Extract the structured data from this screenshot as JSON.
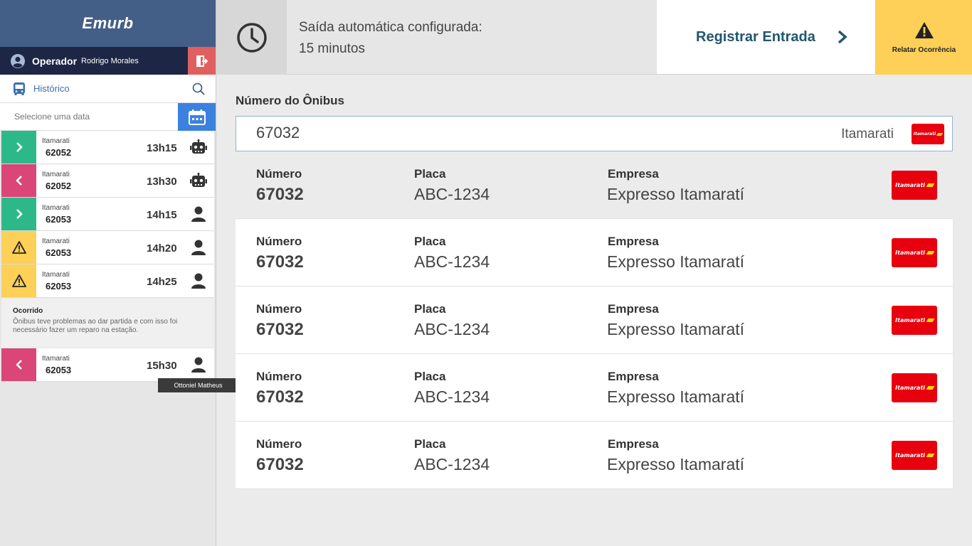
{
  "brand": "Emurb",
  "operator": {
    "label": "Operador",
    "name": "Rodrigo Morales"
  },
  "history": {
    "label": "Histórico",
    "date_placeholder": "Selecione uma data",
    "items": [
      {
        "direction": "in",
        "color": "#2db88a",
        "company": "Itamarati",
        "bus": "62052",
        "time": "13h15",
        "type": "robot-icon"
      },
      {
        "direction": "out",
        "color": "#d94677",
        "company": "Itamarati",
        "bus": "62052",
        "time": "13h30",
        "type": "robot-icon"
      },
      {
        "direction": "in",
        "color": "#2db88a",
        "company": "Itamarati",
        "bus": "62053",
        "time": "14h15",
        "type": "person-icon"
      },
      {
        "direction": "warning",
        "color": "#ffd057",
        "company": "Itamarati",
        "bus": "62053",
        "time": "14h20",
        "type": "person-icon"
      },
      {
        "direction": "warning",
        "color": "#ffd057",
        "company": "Itamarati",
        "bus": "62053",
        "time": "14h25",
        "type": "person-icon"
      },
      {
        "direction": "out",
        "color": "#d94677",
        "company": "Itamarati",
        "bus": "62053",
        "time": "15h30",
        "type": "person-icon"
      }
    ],
    "occurrence": {
      "title": "Ocorrido",
      "text": "Ônibus teve problemas ao dar partida e com isso foi necessário fazer um reparo na estação."
    },
    "tooltip": "Ottoniel Matheus"
  },
  "topbar": {
    "auto_exit_line1": "Saída automática configurada:",
    "auto_exit_line2": "15 minutos",
    "register_label": "Registrar Entrada",
    "report_label": "Relatar Ocorrência"
  },
  "main": {
    "title": "Número do Ônibus",
    "search_value": "67032",
    "search_company": "Itamarati",
    "logo_text": "Itamarati",
    "results": [
      {
        "numero_label": "Número",
        "numero": "67032",
        "placa_label": "Placa",
        "placa": "ABC-1234",
        "empresa_label": "Empresa",
        "empresa": "Expresso Itamaratí"
      },
      {
        "numero_label": "Número",
        "numero": "67032",
        "placa_label": "Placa",
        "placa": "ABC-1234",
        "empresa_label": "Empresa",
        "empresa": "Expresso Itamaratí"
      },
      {
        "numero_label": "Número",
        "numero": "67032",
        "placa_label": "Placa",
        "placa": "ABC-1234",
        "empresa_label": "Empresa",
        "empresa": "Expresso Itamaratí"
      },
      {
        "numero_label": "Número",
        "numero": "67032",
        "placa_label": "Placa",
        "placa": "ABC-1234",
        "empresa_label": "Empresa",
        "empresa": "Expresso Itamaratí"
      },
      {
        "numero_label": "Número",
        "numero": "67032",
        "placa_label": "Placa",
        "placa": "ABC-1234",
        "empresa_label": "Empresa",
        "empresa": "Expresso Itamaratí"
      }
    ]
  },
  "colors": {
    "brand": "#445f87",
    "navy": "#1d2745",
    "logout": "#e0605f",
    "accent": "#3b82e0",
    "entry": "#2db88a",
    "exit": "#d94677",
    "warning": "#ffd057",
    "company_red": "#e8000f",
    "register_text": "#21566e"
  }
}
